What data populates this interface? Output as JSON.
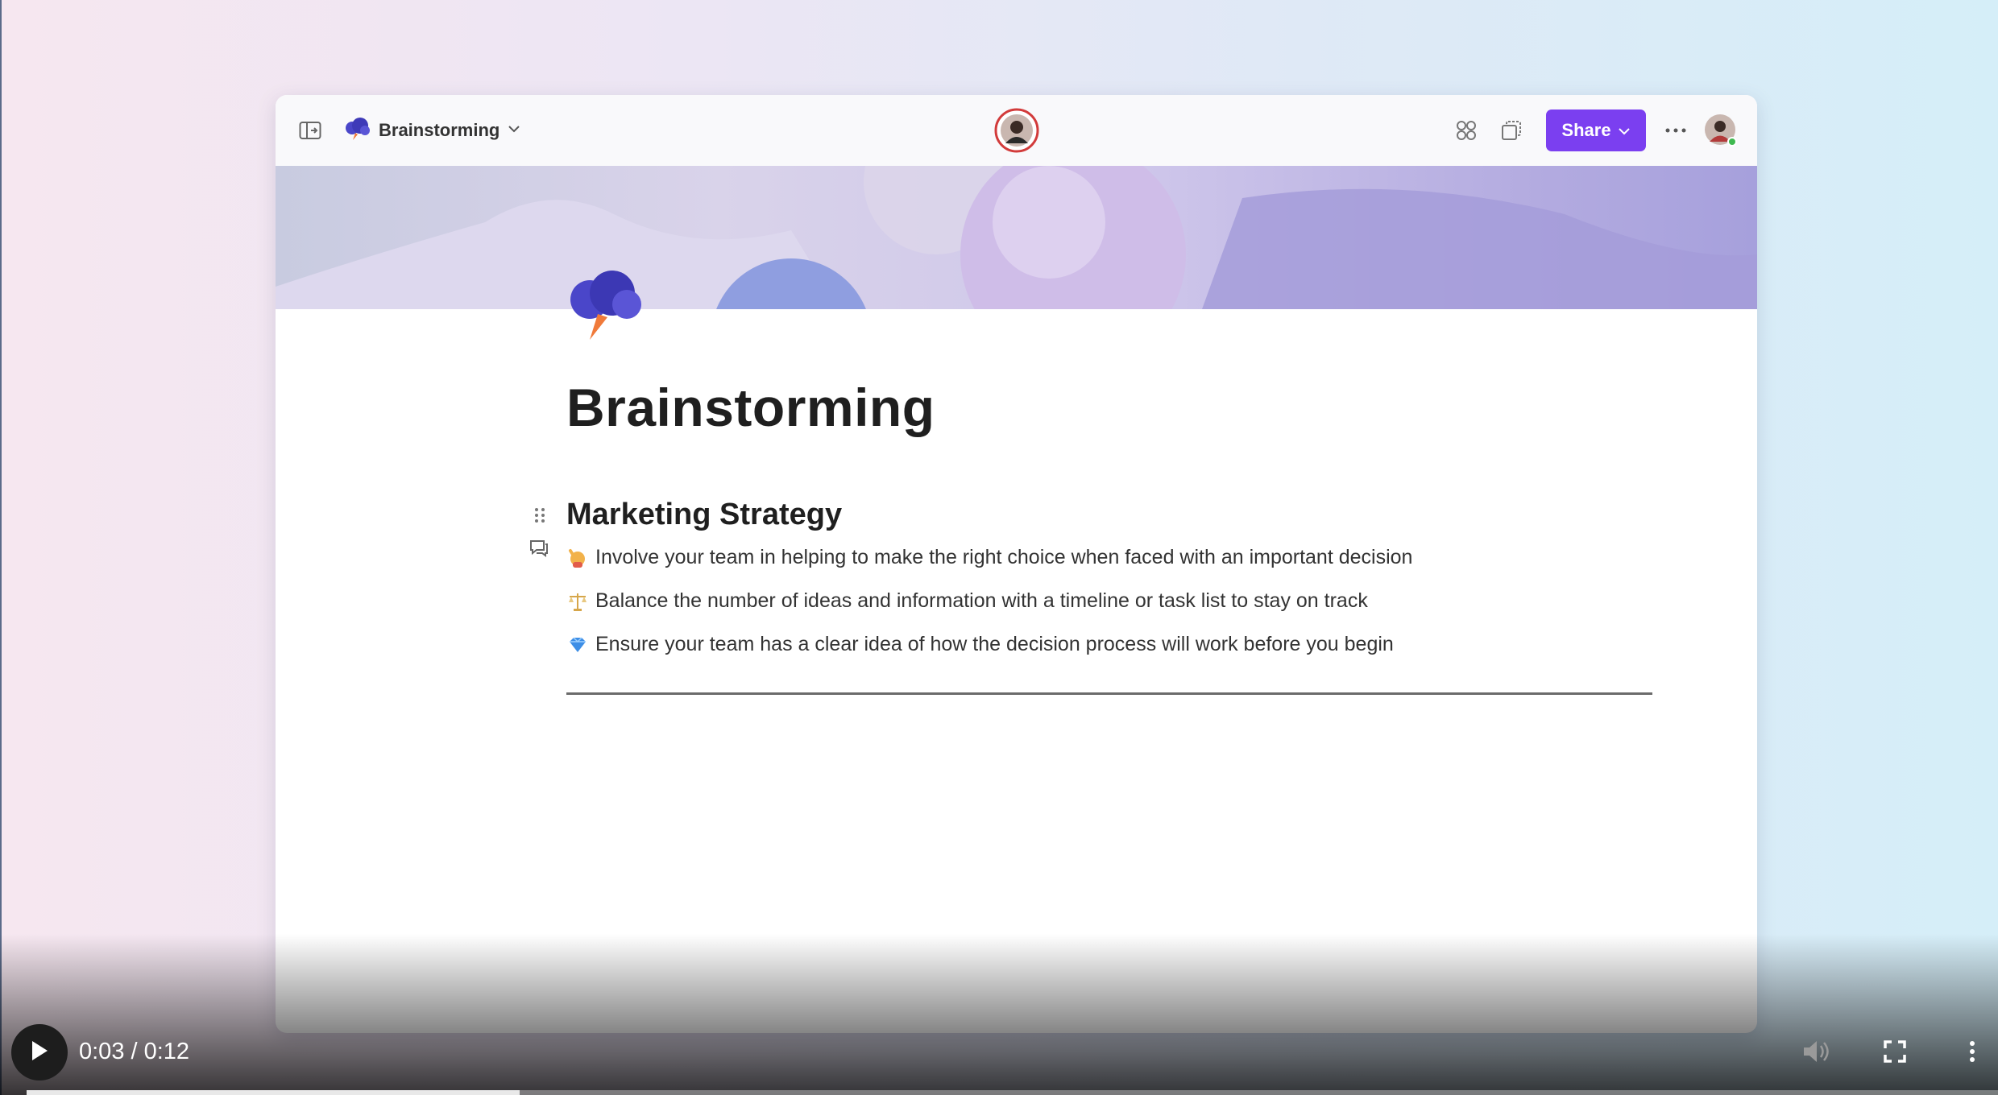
{
  "app": {
    "page_title": "Brainstorming",
    "share_label": "Share",
    "accent_color": "#7b3ff0"
  },
  "document": {
    "title": "Brainstorming",
    "section_heading": "Marketing Strategy",
    "bullets": [
      {
        "icon": "raising-hand-emoji",
        "text": "Involve your team in helping to make the right choice when faced with an important decision"
      },
      {
        "icon": "balance-scale-emoji",
        "text": "Balance the number of ideas and information with a timeline or task list to stay on track"
      },
      {
        "icon": "gem-emoji",
        "text": "Ensure your team has a clear idea of how the decision process will work before you begin"
      }
    ]
  },
  "video": {
    "time_display": "0:03 / 0:12",
    "progress_fraction": 0.25
  },
  "icons": {
    "sidebar_toggle": "sidebar-toggle-icon",
    "page": "storm-cloud-icon",
    "chevron": "chevron-down-icon",
    "collaborator": "collaborator-avatar",
    "apps": "apps-grid-icon",
    "copy": "copy-icon",
    "more": "more-icon",
    "user": "user-avatar"
  }
}
